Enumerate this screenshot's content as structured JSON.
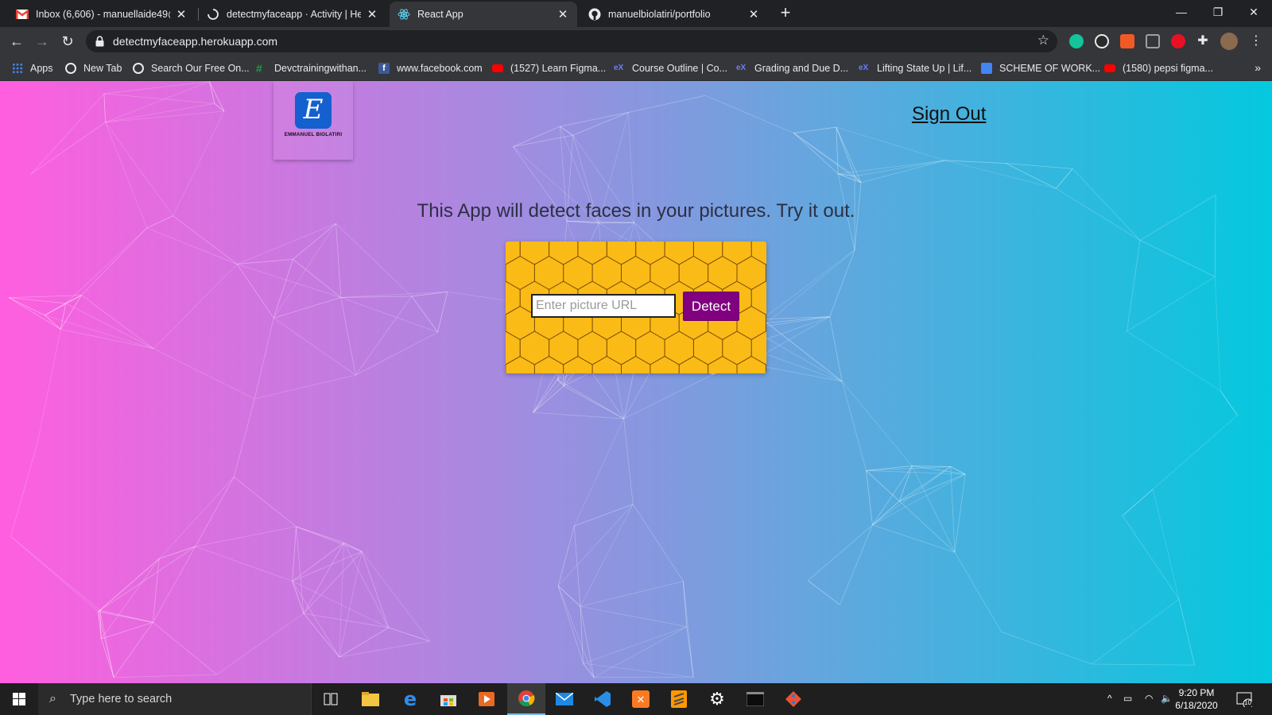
{
  "browser": {
    "tabs": [
      {
        "title": "Inbox (6,606) - manuellaide49@g",
        "icon": "gmail-icon"
      },
      {
        "title": "detectmyfaceapp · Activity | Hero",
        "icon": "loading-icon"
      },
      {
        "title": "React App",
        "icon": "react-icon",
        "active": true
      },
      {
        "title": "manuelbiolatiri/portfolio",
        "icon": "github-icon"
      }
    ],
    "new_tab_label": "+",
    "address": "detectmyfaceapp.herokuapp.com",
    "bookmarks": [
      {
        "label": "Apps",
        "icon": "apps-grid-icon"
      },
      {
        "label": "New Tab",
        "icon": "globe-icon"
      },
      {
        "label": "Search Our Free On...",
        "icon": "globe-icon"
      },
      {
        "label": "Devctrainingwithan...",
        "icon": "devc-icon"
      },
      {
        "label": "www.facebook.com",
        "icon": "facebook-icon"
      },
      {
        "label": "(1527) Learn Figma...",
        "icon": "youtube-icon"
      },
      {
        "label": "Course Outline | Co...",
        "icon": "edx-icon"
      },
      {
        "label": "Grading and Due D...",
        "icon": "edx-icon"
      },
      {
        "label": "Lifting State Up | Lif...",
        "icon": "edx-icon"
      },
      {
        "label": "SCHEME OF WORK...",
        "icon": "docs-icon"
      },
      {
        "label": "(1580) pepsi figma...",
        "icon": "youtube-icon"
      }
    ],
    "more_label": "»"
  },
  "page": {
    "logo_letter": "E",
    "logo_text": "EMMANUEL BIOLATIRI",
    "sign_out_label": "Sign Out",
    "tagline": "This App will detect faces in your pictures. Try it out.",
    "url_input_placeholder": "Enter picture URL",
    "url_input_value": "",
    "detect_label": "Detect"
  },
  "taskbar": {
    "search_placeholder": "Type here to search",
    "time": "9:20 PM",
    "date": "6/18/2020",
    "notification_count": "10",
    "apps": [
      "task-view-icon",
      "file-explorer-icon",
      "edge-icon",
      "store-icon",
      "media-player-icon",
      "chrome-icon",
      "mail-icon",
      "vscode-icon",
      "xampp-icon",
      "sublime-icon",
      "settings-icon",
      "terminal-icon",
      "git-icon"
    ]
  },
  "colors": {
    "gradient_left": "#ff5edf",
    "gradient_right": "#04c8de",
    "honeycomb": "#fbbb16",
    "detect_button": "#800080",
    "logo_blue": "#1460cf"
  }
}
